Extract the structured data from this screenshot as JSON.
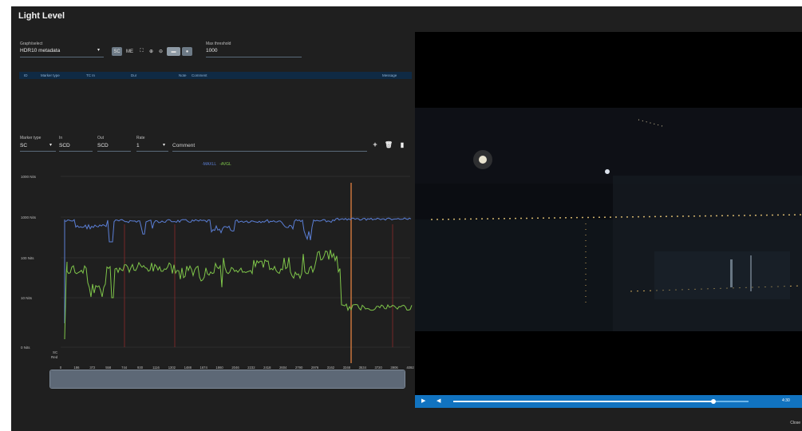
{
  "app": {
    "title": "Light Level"
  },
  "toolbar": {
    "graph_select": {
      "label": "Graph/select",
      "value": "HDR10 metadata"
    },
    "buttons": [
      "SC",
      "ME"
    ],
    "max_threshold": {
      "label": "Max threshold",
      "value": "1000"
    }
  },
  "table": {
    "headers": [
      "ID",
      "Marker type",
      "TC In",
      "Dur",
      "Note",
      "Comment",
      "Message"
    ]
  },
  "marker_form": {
    "marker_type": {
      "label": "Marker type",
      "value": "SC"
    },
    "in": {
      "label": "In",
      "value": "SCD"
    },
    "out": {
      "label": "Out",
      "value": "SCD"
    },
    "rate": {
      "label": "Rate",
      "value": "1"
    },
    "comment": {
      "value": "Comment"
    }
  },
  "chart_data": {
    "type": "line",
    "legend": [
      "-MAXLL",
      "-AVGL"
    ],
    "ylabels": [
      "1000 Nits",
      "1000 Nits",
      "100 Nits",
      "10 Nits",
      "0 Nits"
    ],
    "xlabels": [
      "0",
      "186",
      "372",
      "558",
      "744",
      "930",
      "1116",
      "1302",
      "1488",
      "1674",
      "1860",
      "2046",
      "2232",
      "2418",
      "2604",
      "2790",
      "2976",
      "3162",
      "3348",
      "3534",
      "3720",
      "3906",
      "4092"
    ],
    "yextra": [
      "SC",
      "Red"
    ],
    "series": [
      {
        "name": "MAXLL",
        "color": "#5b7fd6"
      },
      {
        "name": "AVGL",
        "color": "#7fc64a"
      }
    ],
    "cursor_color": "#c8743d",
    "marker_color": "#8a2a2a"
  },
  "player": {
    "play_icon": "play-icon",
    "volume_icon": "volume-icon",
    "time": "4:30",
    "progress": 0.88
  },
  "footer": {
    "close_label": "Close"
  }
}
